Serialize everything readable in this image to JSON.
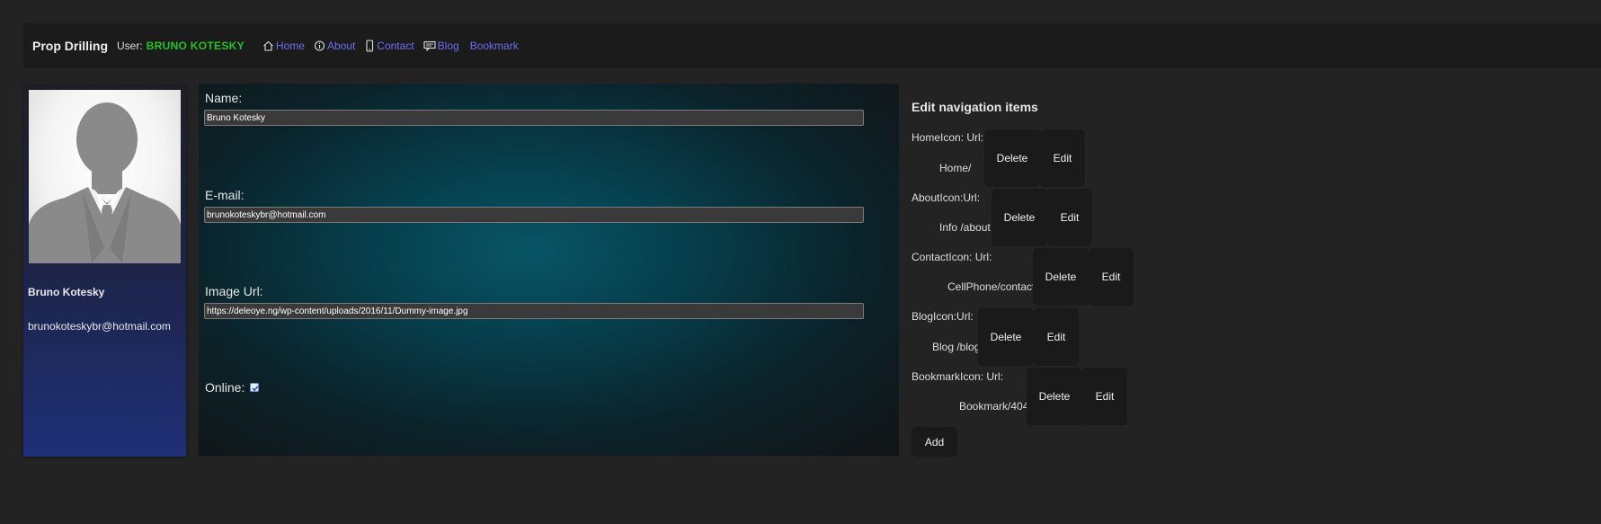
{
  "header": {
    "brand": "Prop Drilling",
    "user_label": "User:",
    "user_name": "BRUNO KOTESKY",
    "nav": [
      {
        "label": "Home",
        "icon": "home-icon"
      },
      {
        "label": "About",
        "icon": "info-icon"
      },
      {
        "label": "Contact",
        "icon": "cellphone-icon"
      },
      {
        "label": "Blog",
        "icon": "blog-icon"
      },
      {
        "label": "Bookmark",
        "icon": ""
      }
    ]
  },
  "profile": {
    "name": "Bruno Kotesky",
    "email": "brunokoteskybr@hotmail.com"
  },
  "form": {
    "name_label": "Name:",
    "name_value": "Bruno Kotesky",
    "email_label": "E-mail:",
    "email_value": "brunokoteskybr@hotmail.com",
    "image_label": "Image Url:",
    "image_value": "https://deleoye.ng/wp-content/uploads/2016/11/Dummy-image.jpg",
    "online_label": "Online:",
    "online_checked": true
  },
  "edit_nav": {
    "title": "Edit navigation items",
    "items": [
      {
        "line1": "HomeIcon:  Url:",
        "line2": "Home/"
      },
      {
        "line1": "AboutIcon:Url:",
        "line2": "Info  /about"
      },
      {
        "line1": "ContactIcon:        Url:",
        "line2": "CellPhone/contact"
      },
      {
        "line1": "BlogIcon:Url:",
        "line2": "Blog /blog"
      },
      {
        "line1": "BookmarkIcon:        Url:",
        "line2": "Bookmark/404"
      }
    ],
    "delete_label": "Delete",
    "edit_label": "Edit",
    "add_label": "Add"
  },
  "colors": {
    "accent_link": "#6a6ff5",
    "user_green": "#21c421",
    "header_bg": "#1b1b1b",
    "page_bg": "#232323"
  }
}
